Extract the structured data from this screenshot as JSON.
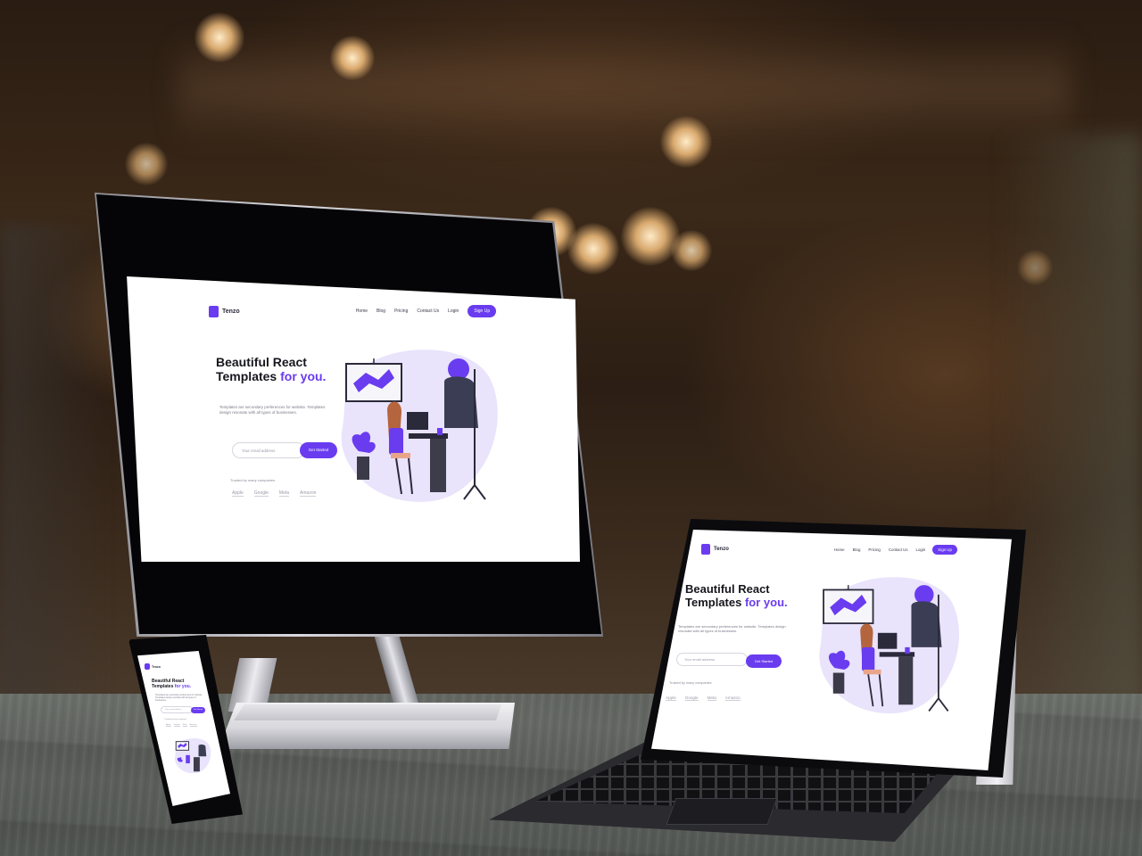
{
  "site": {
    "logo_text": "Tenzo",
    "menu": [
      "Home",
      "Blog",
      "Pricing",
      "Contact Us"
    ],
    "login_label": "Login",
    "cta_nav_label": "Sign Up",
    "headline_line1": "Beautiful React",
    "headline_line2_prefix": "Templates",
    "headline_line2_accent": "for you.",
    "paragraph": "Templates are secondary preferences for website. Templates design resonate with all types of businesses.",
    "email_placeholder": "Your email address",
    "cta_label": "Get Started",
    "trusted_label": "Trusted by many companies",
    "partners": [
      "Apple",
      "Google",
      "Meta",
      "Amazon"
    ]
  },
  "colors": {
    "accent": "#6a3cf0",
    "screen_bg": "#ffffff",
    "table": "#5f625e"
  },
  "icons": [
    "logo-mark-icon",
    "illustration-monitor-icon",
    "illustration-plant-icon",
    "illustration-coat-icon"
  ]
}
